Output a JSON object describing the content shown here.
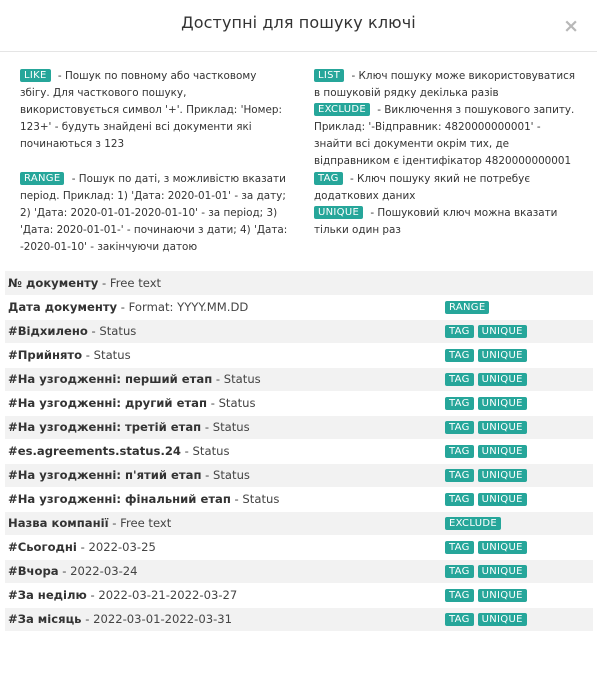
{
  "modal": {
    "title": "Доступні для пошуку ключі",
    "close_glyph": "×"
  },
  "legend": {
    "like": {
      "badge": "LIKE",
      "text": "- Пошук по повному або частковому збігу. Для часткового пошуку, використовується символ '+'. Приклад: 'Номер: 123+' - будуть знайдені всі документи які починаються з 123"
    },
    "list": {
      "badge": "LIST",
      "text": "- Ключ пошуку може використовуватися в пошуковій рядку декілька разів"
    },
    "exclude": {
      "badge": "EXCLUDE",
      "text": "- Виключення з пошукового запиту. Приклад: '-Відправник: 4820000000001' - знайти всі документи окрім тих, де відправником є ідентифікатор 4820000000001"
    },
    "range": {
      "badge": "RANGE",
      "text": "- Пошук по даті, з можливістю вказати період. Приклад: 1) 'Дата: 2020-01-01' - за дату; 2) 'Дата: 2020-01-01-2020-01-10' - за період; 3) 'Дата: 2020-01-01-' - починаючи з дати; 4) 'Дата: -2020-01-10' - закінчуючи датою"
    },
    "tag": {
      "badge": "TAG",
      "text": "- Ключ пошуку який не потребує додаткових даних"
    },
    "unique": {
      "badge": "UNIQUE",
      "text": "- Пошуковий ключ можна вказати тільки один раз"
    }
  },
  "rows": [
    {
      "name": "№ документу",
      "desc": " - Free text",
      "badges": []
    },
    {
      "name": "Дата документу",
      "desc": " - Format: YYYY.MM.DD",
      "badges": [
        "RANGE"
      ]
    },
    {
      "name": "#Відхилено",
      "desc": " - Status",
      "badges": [
        "TAG",
        "UNIQUE"
      ]
    },
    {
      "name": "#Прийнято",
      "desc": " - Status",
      "badges": [
        "TAG",
        "UNIQUE"
      ]
    },
    {
      "name": "#На узгодженні: перший етап",
      "desc": " - Status",
      "badges": [
        "TAG",
        "UNIQUE"
      ]
    },
    {
      "name": "#На узгодженні: другий етап",
      "desc": " - Status",
      "badges": [
        "TAG",
        "UNIQUE"
      ]
    },
    {
      "name": "#На узгодженні: третій етап",
      "desc": " - Status",
      "badges": [
        "TAG",
        "UNIQUE"
      ]
    },
    {
      "name": "#es.agreements.status.24",
      "desc": " - Status",
      "badges": [
        "TAG",
        "UNIQUE"
      ]
    },
    {
      "name": "#На узгодженні: п'ятий етап",
      "desc": " - Status",
      "badges": [
        "TAG",
        "UNIQUE"
      ]
    },
    {
      "name": "#На узгодженні: фінальний етап",
      "desc": " - Status",
      "badges": [
        "TAG",
        "UNIQUE"
      ]
    },
    {
      "name": "Назва компанії",
      "desc": " - Free text",
      "badges": [
        "EXCLUDE"
      ]
    },
    {
      "name": "#Сьогодні",
      "desc": " - 2022-03-25",
      "badges": [
        "TAG",
        "UNIQUE"
      ]
    },
    {
      "name": "#Вчора",
      "desc": " - 2022-03-24",
      "badges": [
        "TAG",
        "UNIQUE"
      ]
    },
    {
      "name": "#За неділю",
      "desc": " - 2022-03-21-2022-03-27",
      "badges": [
        "TAG",
        "UNIQUE"
      ]
    },
    {
      "name": "#За місяць",
      "desc": " - 2022-03-01-2022-03-31",
      "badges": [
        "TAG",
        "UNIQUE"
      ]
    }
  ],
  "colors": {
    "badge_bg": "#26a69a",
    "stripe": "#f2f2f2"
  }
}
